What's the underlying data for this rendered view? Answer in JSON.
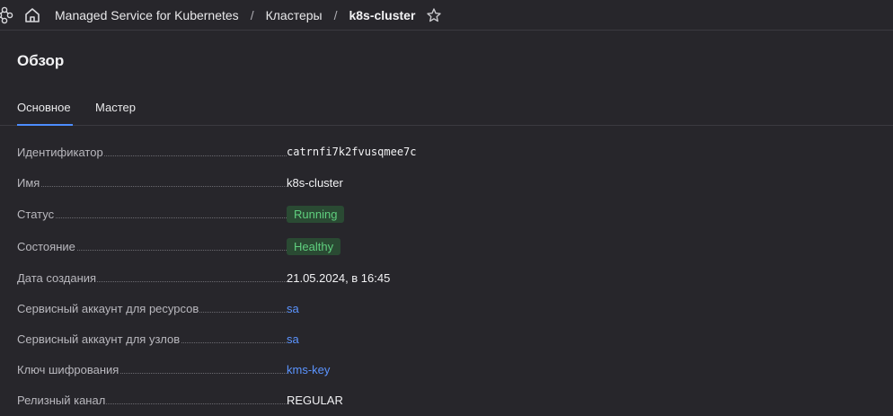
{
  "topbar": {
    "nodes_icon": "nodes-icon",
    "home_icon": "home-icon",
    "breadcrumb": {
      "service": "Managed Service for Kubernetes",
      "separator": "/",
      "clusters": "Кластеры",
      "cluster": "k8s-cluster"
    },
    "star_icon": "star-icon"
  },
  "page": {
    "title": "Обзор"
  },
  "tabs": [
    {
      "label": "Основное",
      "active": true
    },
    {
      "label": "Мастер",
      "active": false
    }
  ],
  "properties": {
    "id": {
      "label": "Идентификатор",
      "value": "catrnfi7k2fvusqmee7c"
    },
    "name": {
      "label": "Имя",
      "value": "k8s-cluster"
    },
    "status": {
      "label": "Статус",
      "value": "Running"
    },
    "health": {
      "label": "Состояние",
      "value": "Healthy"
    },
    "created": {
      "label": "Дата создания",
      "value": "21.05.2024, в 16:45"
    },
    "sa_resources": {
      "label": "Сервисный аккаунт для ресурсов",
      "value": "sa"
    },
    "sa_nodes": {
      "label": "Сервисный аккаунт для узлов",
      "value": "sa"
    },
    "kms_key": {
      "label": "Ключ шифрования",
      "value": "kms-key"
    },
    "release_channel": {
      "label": "Релизный канал",
      "value": "REGULAR"
    }
  },
  "colors": {
    "background": "#27262b",
    "accent": "#4d8dff",
    "link": "#5b94ff",
    "badge_bg": "#2a4a33",
    "badge_text": "#5fcf7e"
  }
}
